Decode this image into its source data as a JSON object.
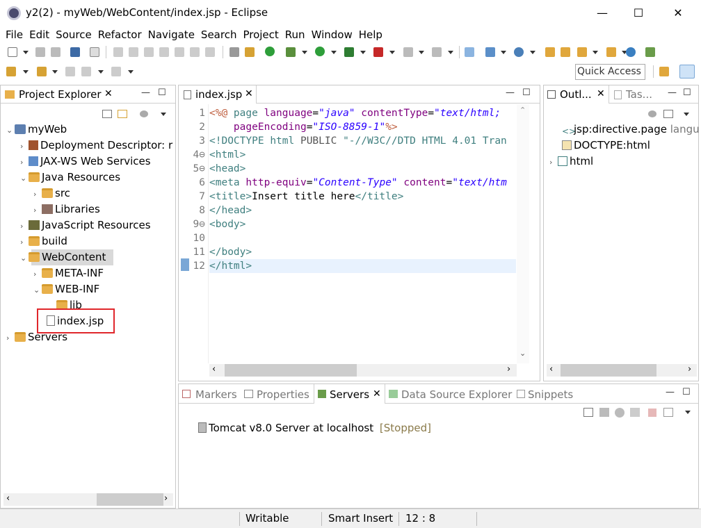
{
  "window": {
    "title": "y2(2) - myWeb/WebContent/index.jsp - Eclipse"
  },
  "window_controls": {
    "minimize": "—",
    "maximize": "☐",
    "close": "✕"
  },
  "menu": [
    "File",
    "Edit",
    "Source",
    "Refactor",
    "Navigate",
    "Search",
    "Project",
    "Run",
    "Window",
    "Help"
  ],
  "quick_access": "Quick Access",
  "project_explorer": {
    "tab_label": "Project Explorer",
    "items": [
      {
        "label": "myWeb",
        "icon": "project-icon",
        "expanded": true
      },
      {
        "label": "Deployment Descriptor: r",
        "icon": "descriptor-icon"
      },
      {
        "label": "JAX-WS Web Services",
        "icon": "webservice-icon"
      },
      {
        "label": "Java Resources",
        "icon": "java-resources-icon",
        "expanded": true
      },
      {
        "label": "src",
        "icon": "package-folder-icon"
      },
      {
        "label": "Libraries",
        "icon": "libraries-icon"
      },
      {
        "label": "JavaScript Resources",
        "icon": "js-resources-icon"
      },
      {
        "label": "build",
        "icon": "folder-icon"
      },
      {
        "label": "WebContent",
        "icon": "folder-icon",
        "expanded": true,
        "selected": true
      },
      {
        "label": "META-INF",
        "icon": "folder-icon"
      },
      {
        "label": "WEB-INF",
        "icon": "folder-icon",
        "expanded": true
      },
      {
        "label": "lib",
        "icon": "folder-icon"
      },
      {
        "label": "index.jsp",
        "icon": "jsp-file-icon",
        "highlighted": true
      },
      {
        "label": "Servers",
        "icon": "folder-icon"
      }
    ]
  },
  "editor": {
    "tab_label": "index.jsp",
    "line_numbers": [
      "1",
      "2",
      "3",
      "4⊖",
      "5⊖",
      "6",
      "7",
      "8",
      "9⊖",
      "10",
      "11",
      "12"
    ],
    "lines": [
      [
        {
          "t": "<%@ ",
          "c": "dir"
        },
        {
          "t": "page ",
          "c": "kw"
        },
        {
          "t": "language",
          "c": "at"
        },
        {
          "t": "=",
          "c": ""
        },
        {
          "t": "\"java\"",
          "c": "str"
        },
        {
          "t": " ",
          "c": ""
        },
        {
          "t": "contentType",
          "c": "at"
        },
        {
          "t": "=",
          "c": ""
        },
        {
          "t": "\"text/html;",
          "c": "str"
        }
      ],
      [
        {
          "t": "    ",
          "c": ""
        },
        {
          "t": "pageEncoding",
          "c": "at"
        },
        {
          "t": "=",
          "c": ""
        },
        {
          "t": "\"ISO-8859-1\"",
          "c": "str"
        },
        {
          "t": "%>",
          "c": "dir"
        }
      ],
      [
        {
          "t": "<!DOCTYPE ",
          "c": "kw"
        },
        {
          "t": "html ",
          "c": "kw"
        },
        {
          "t": "PUBLIC ",
          "c": "gray"
        },
        {
          "t": "\"-//W3C//DTD HTML 4.01 Tran",
          "c": "kw"
        }
      ],
      [
        {
          "t": "<html>",
          "c": "kw"
        }
      ],
      [
        {
          "t": "<head>",
          "c": "kw"
        }
      ],
      [
        {
          "t": "<meta ",
          "c": "kw"
        },
        {
          "t": "http-equiv",
          "c": "at"
        },
        {
          "t": "=",
          "c": ""
        },
        {
          "t": "\"Content-Type\"",
          "c": "str"
        },
        {
          "t": " ",
          "c": ""
        },
        {
          "t": "content",
          "c": "at"
        },
        {
          "t": "=",
          "c": ""
        },
        {
          "t": "\"text/htm",
          "c": "str"
        }
      ],
      [
        {
          "t": "<title>",
          "c": "kw"
        },
        {
          "t": "Insert title here",
          "c": ""
        },
        {
          "t": "</title>",
          "c": "kw"
        }
      ],
      [
        {
          "t": "</head>",
          "c": "kw"
        }
      ],
      [
        {
          "t": "<body>",
          "c": "kw"
        }
      ],
      [
        {
          "t": "",
          "c": ""
        }
      ],
      [
        {
          "t": "</body>",
          "c": "kw"
        }
      ],
      [
        {
          "t": "</html>",
          "c": "kw"
        }
      ]
    ]
  },
  "outline": {
    "tabs": [
      "Outl...",
      "Tas..."
    ],
    "items": [
      {
        "label": "jsp:directive.page",
        "suffix": " langu",
        "icon": "directive-icon"
      },
      {
        "label": "DOCTYPE:html",
        "icon": "doctype-icon"
      },
      {
        "label": "html",
        "icon": "tag-icon"
      }
    ]
  },
  "bottom_panel": {
    "tabs": [
      "Markers",
      "Properties",
      "Servers",
      "Data Source Explorer",
      "Snippets"
    ],
    "server": {
      "name": "Tomcat v8.0 Server at localhost",
      "state": "[Stopped]"
    }
  },
  "status": {
    "mode": "Writable",
    "insert": "Smart Insert",
    "position": "12 : 8"
  },
  "colors": {
    "selection": "#d9d9d9",
    "highlight_box": "#e0262b",
    "current_line": "#e8f2fe"
  }
}
